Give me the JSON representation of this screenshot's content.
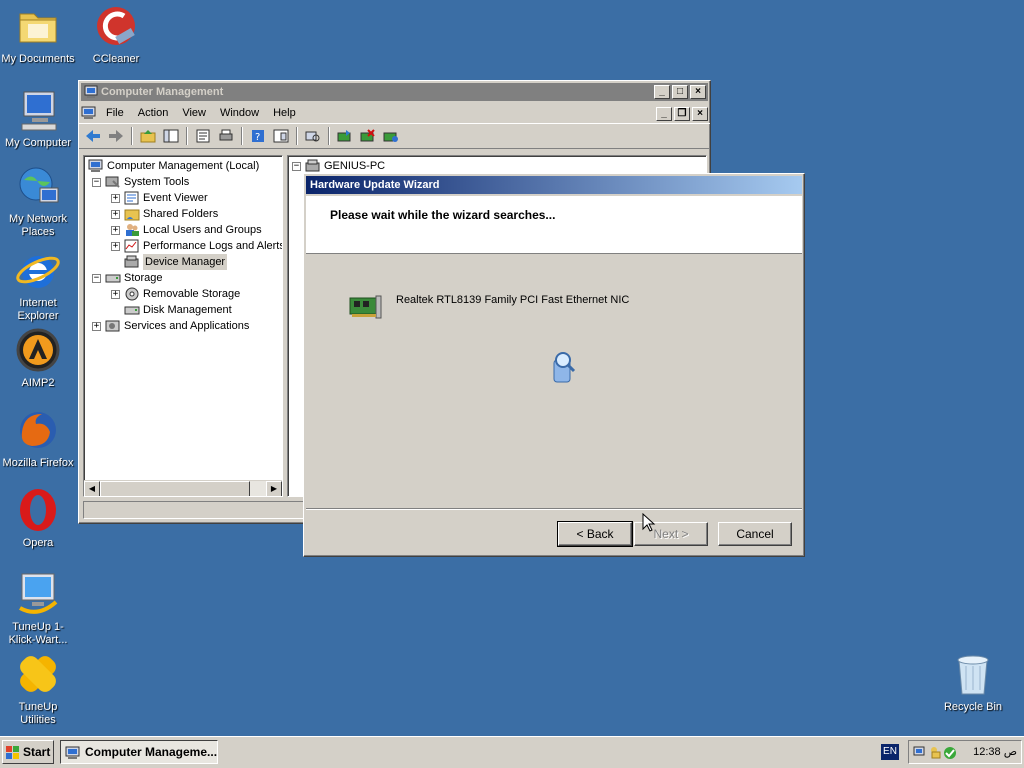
{
  "desktop": {
    "icons_left": [
      {
        "label": "My Documents"
      },
      {
        "label": "My Computer"
      },
      {
        "label": "My Network Places"
      },
      {
        "label": "Internet Explorer"
      },
      {
        "label": "AIMP2"
      },
      {
        "label": "Mozilla Firefox"
      },
      {
        "label": "Opera"
      },
      {
        "label": "TuneUp 1-Klick-Wart..."
      },
      {
        "label": "TuneUp Utilities"
      }
    ],
    "ccleaner": {
      "label": "CCleaner"
    },
    "recycle_bin": {
      "label": "Recycle Bin"
    }
  },
  "mmc": {
    "title": "Computer Management",
    "menu": [
      "File",
      "Action",
      "View",
      "Window",
      "Help"
    ],
    "tree": [
      {
        "label": "Computer Management (Local)"
      },
      {
        "label": "System Tools"
      },
      {
        "label": "Event Viewer"
      },
      {
        "label": "Shared Folders"
      },
      {
        "label": "Local Users and Groups"
      },
      {
        "label": "Performance Logs and Alerts"
      },
      {
        "label": "Device Manager"
      },
      {
        "label": "Storage"
      },
      {
        "label": "Removable Storage"
      },
      {
        "label": "Disk Management"
      },
      {
        "label": "Services and Applications"
      }
    ],
    "right_root": "GENIUS-PC",
    "expander_plus": "+",
    "expander_minus": "−"
  },
  "wizard": {
    "title": "Hardware Update Wizard",
    "heading": "Please wait while the wizard searches...",
    "device": "Realtek RTL8139 Family PCI Fast Ethernet NIC",
    "back": "< Back",
    "next": "Next >",
    "cancel": "Cancel"
  },
  "taskbar": {
    "start": "Start",
    "task": "Computer Manageme...",
    "lang": "EN",
    "clock": "12:38 ص"
  },
  "colors": {
    "desktop": "#3b6ea5",
    "title_active": "#0a246a",
    "title_inactive": "#808080"
  }
}
